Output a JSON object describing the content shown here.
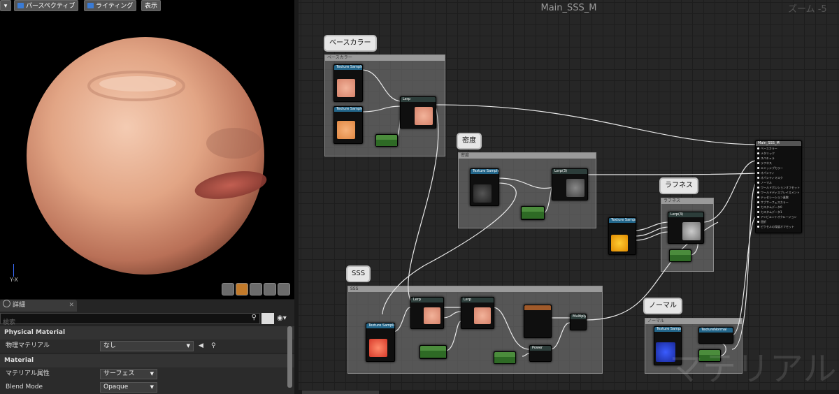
{
  "viewport": {
    "buttons": {
      "perspective": "パースペクティブ",
      "lighting": "ライティング",
      "show": "表示"
    },
    "axis_label": "Y-X"
  },
  "details": {
    "tab_label": "詳細",
    "search_placeholder": "検索",
    "sections": {
      "physical": "Physical Material",
      "material": "Material"
    },
    "props": {
      "phys_mat_label": "物理マテリアル",
      "phys_mat_value": "なし",
      "mat_domain_label": "マテリアル属性",
      "mat_domain_value": "サーフェス",
      "blend_label": "Blend Mode",
      "blend_value": "Opaque"
    }
  },
  "graph": {
    "title": "Main_SSS_M",
    "zoom": "ズーム -5",
    "watermark": "マテリアル",
    "comments": {
      "base_color": "ベースカラー",
      "density": "密度",
      "roughness": "ラフネス",
      "sss": "SSS",
      "normal": "ノーマル"
    },
    "nodes": {
      "texture_sample": "Texture Sample",
      "lerp": "Lerp",
      "lerp3": "Lerp(3)",
      "power": "Power",
      "multiply": "Multiply",
      "texture_normal": "TextureNormal",
      "main_node": "Main_SSS_M"
    },
    "pins": [
      "UVs",
      "Tex",
      "A",
      "B",
      "Alpha",
      "Base",
      "Exp"
    ],
    "main_pins": [
      "ベースカラー",
      "メタリック",
      "スペキュラ",
      "ラフネス",
      "エミッシブカラー",
      "オパシティ",
      "オパシティマスク",
      "ノーマル",
      "ワールドポジションオフセット",
      "ワールドディスプレイスメント",
      "テッセレーション乗数",
      "サブサーフェスカラー",
      "カスタムデータ0",
      "カスタムデータ1",
      "アンビエントオクルージョン",
      "屈折",
      "ピクセルの深度オフセット"
    ]
  },
  "colors": {
    "node_header_blue": "#23668a",
    "node_header_green": "#4b8c3c",
    "wire": "#e8e8e8"
  }
}
